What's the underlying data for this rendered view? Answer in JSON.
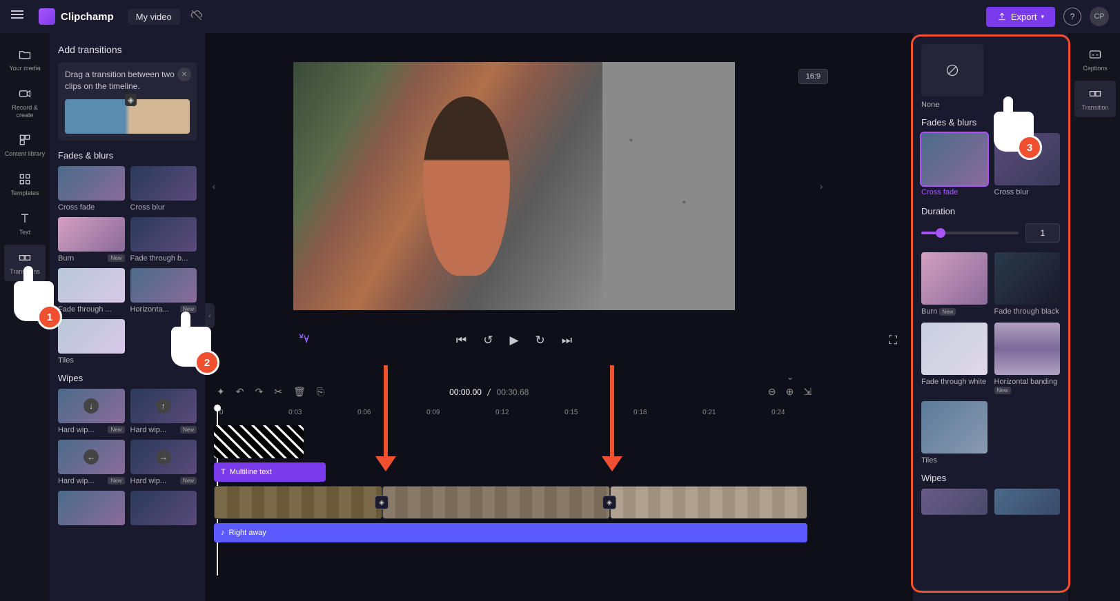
{
  "header": {
    "brand": "Clipchamp",
    "title": "My video",
    "export_label": "Export",
    "avatar_initials": "CP"
  },
  "left_nav": [
    {
      "id": "your-media",
      "label": "Your media"
    },
    {
      "id": "record-create",
      "label": "Record & create"
    },
    {
      "id": "content-library",
      "label": "Content library"
    },
    {
      "id": "templates",
      "label": "Templates"
    },
    {
      "id": "text",
      "label": "Text"
    },
    {
      "id": "transitions",
      "label": "Transitions"
    }
  ],
  "left_panel": {
    "title": "Add transitions",
    "tip": "Drag a transition between two clips on the timeline.",
    "sections": [
      {
        "name": "Fades & blurs",
        "items": [
          {
            "label": "Cross fade",
            "new": false
          },
          {
            "label": "Cross blur",
            "new": false
          },
          {
            "label": "Burn",
            "new": true
          },
          {
            "label": "Fade through b...",
            "new": false
          },
          {
            "label": "Fade through ...",
            "new": false
          },
          {
            "label": "Horizonta...",
            "new": true
          },
          {
            "label": "Tiles",
            "new": false
          }
        ]
      },
      {
        "name": "Wipes",
        "items": [
          {
            "label": "Hard wip...",
            "new": true
          },
          {
            "label": "Hard wip...",
            "new": true
          },
          {
            "label": "Hard wip...",
            "new": true
          },
          {
            "label": "Hard wip...",
            "new": true
          }
        ]
      }
    ]
  },
  "preview": {
    "aspect": "16:9"
  },
  "timeline": {
    "current": "00:00.00",
    "total": "00:30.68",
    "ticks": [
      "0",
      "0:03",
      "0:06",
      "0:09",
      "0:12",
      "0:15",
      "0:18",
      "0:21",
      "0:24"
    ],
    "text_track_label": "Multiline text",
    "audio_track_label": "Right away"
  },
  "right_panel": {
    "none_label": "None",
    "section1": "Fades & blurs",
    "items1": [
      {
        "label": "Cross fade",
        "selected": true,
        "new": false
      },
      {
        "label": "Cross blur",
        "selected": false,
        "new": false
      }
    ],
    "duration_label": "Duration",
    "duration_value": "1",
    "items2": [
      {
        "label": "Burn",
        "new": true
      },
      {
        "label": "Fade through black",
        "new": false
      },
      {
        "label": "Fade through white",
        "new": false
      },
      {
        "label": "Horizontal banding",
        "new": true
      },
      {
        "label": "Tiles",
        "new": false
      }
    ],
    "section2": "Wipes"
  },
  "right_nav": [
    {
      "id": "captions",
      "label": "Captions"
    },
    {
      "id": "transition",
      "label": "Transition"
    }
  ],
  "badges": {
    "new": "New"
  }
}
